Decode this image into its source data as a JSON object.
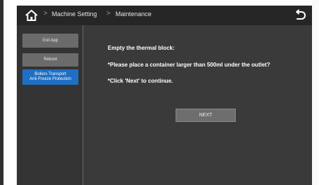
{
  "breadcrumb": {
    "items": [
      "Machine Setting",
      "Maintenance"
    ],
    "separator": ">"
  },
  "sidebar": {
    "items": [
      {
        "label": "Exit App"
      },
      {
        "label": "Reboot"
      },
      {
        "label_line1": "Boilers Transport",
        "label_line2": "Anti-Freeze Protection",
        "active": true
      }
    ]
  },
  "main": {
    "title": "Empty the thermal block:",
    "instruction_1": "*Please place a container larger than 500ml under the outlet?",
    "instruction_2": "*Click 'Next' to continue.",
    "next_label": "NEXT"
  },
  "colors": {
    "background": "#3a3a3a",
    "header": "#262626",
    "active_item": "#1f6fc4",
    "button": "#6b6b6b"
  },
  "icons": {
    "home": "home-icon",
    "back": "back-arrow-icon"
  }
}
